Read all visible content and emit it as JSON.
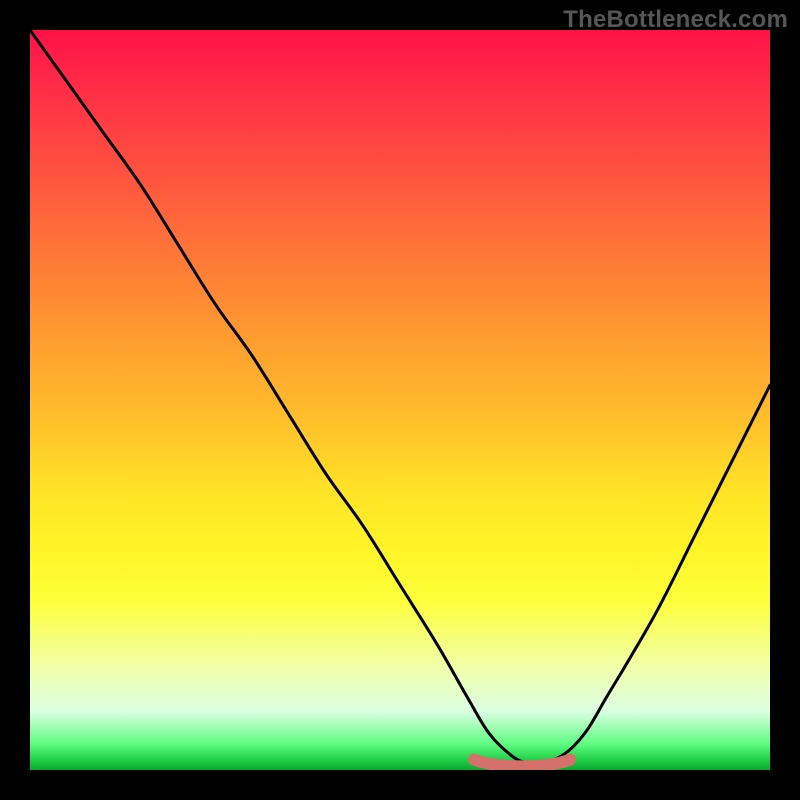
{
  "watermark": "TheBottleneck.com",
  "chart_data": {
    "type": "line",
    "title": "",
    "xlabel": "",
    "ylabel": "",
    "xlim": [
      0,
      100
    ],
    "ylim": [
      0,
      100
    ],
    "grid": false,
    "legend": false,
    "series": [
      {
        "name": "curve",
        "x": [
          0,
          5,
          10,
          15,
          20,
          25,
          30,
          35,
          40,
          45,
          50,
          55,
          59,
          62,
          65,
          67,
          69,
          72,
          75,
          78,
          81,
          85,
          90,
          95,
          100
        ],
        "y": [
          100,
          93,
          86,
          79,
          71,
          63,
          56,
          48,
          40,
          33,
          25,
          17,
          10,
          5,
          2,
          1,
          1,
          2,
          5,
          10,
          15,
          22,
          32,
          42,
          52
        ]
      }
    ],
    "annotation_segment": {
      "name": "highlight",
      "x_start": 60,
      "x_end": 73,
      "y": 1.0,
      "color": "#d4716a"
    },
    "gradient_stops": [
      {
        "pos": 0.0,
        "color": "#ff1148"
      },
      {
        "pos": 0.07,
        "color": "#ff2a47"
      },
      {
        "pos": 0.22,
        "color": "#ff5b3e"
      },
      {
        "pos": 0.37,
        "color": "#ff8d33"
      },
      {
        "pos": 0.52,
        "color": "#ffbd2b"
      },
      {
        "pos": 0.62,
        "color": "#ffe227"
      },
      {
        "pos": 0.7,
        "color": "#fff427"
      },
      {
        "pos": 0.77,
        "color": "#fdff3a"
      },
      {
        "pos": 0.86,
        "color": "#f1ffa7"
      },
      {
        "pos": 0.92,
        "color": "#dcffe2"
      },
      {
        "pos": 0.965,
        "color": "#5efc81"
      },
      {
        "pos": 0.985,
        "color": "#24d24a"
      },
      {
        "pos": 1.0,
        "color": "#0aa62f"
      }
    ]
  }
}
